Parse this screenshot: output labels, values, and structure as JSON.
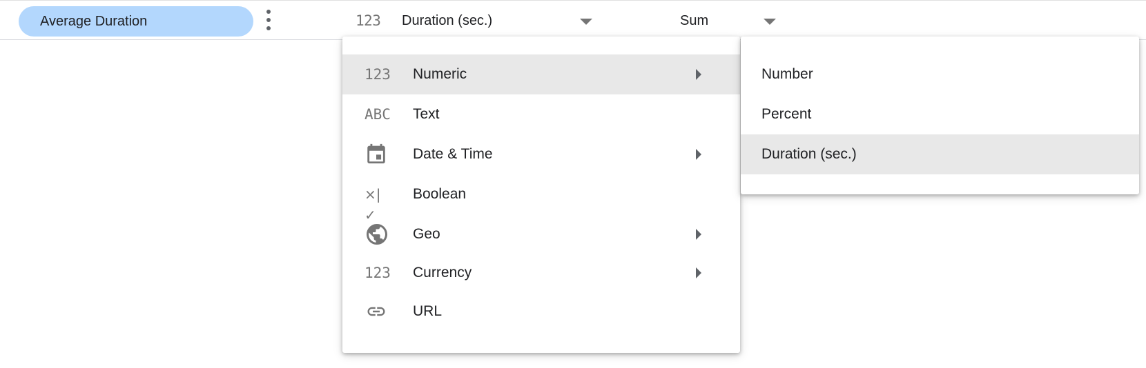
{
  "field_row": {
    "field_name": "Average Duration",
    "type_icon": "123",
    "type_value": "Duration (sec.)",
    "aggregation_value": "Sum"
  },
  "type_menu": {
    "items": [
      {
        "label": "Numeric",
        "icon": "123",
        "icon_name": "numeric-icon",
        "has_submenu": true,
        "highlighted": true
      },
      {
        "label": "Text",
        "icon": "ABC",
        "icon_name": "text-icon",
        "has_submenu": false
      },
      {
        "label": "Date & Time",
        "icon": "calendar",
        "icon_name": "calendar-icon",
        "has_submenu": true
      },
      {
        "label": "Boolean",
        "icon": "×|✓",
        "icon_name": "boolean-icon",
        "has_submenu": false
      },
      {
        "label": "Geo",
        "icon": "globe",
        "icon_name": "globe-icon",
        "has_submenu": true
      },
      {
        "label": "Currency",
        "icon": "123",
        "icon_name": "currency-icon",
        "has_submenu": true
      },
      {
        "label": "URL",
        "icon": "link",
        "icon_name": "link-icon",
        "has_submenu": false
      }
    ]
  },
  "numeric_submenu": {
    "items": [
      {
        "label": "Number"
      },
      {
        "label": "Percent"
      },
      {
        "label": "Duration (sec.)",
        "selected": true
      }
    ]
  },
  "colors": {
    "chip_background": "#b3d7fd",
    "highlight": "#e8e8e8",
    "icon_gray": "#757575"
  }
}
